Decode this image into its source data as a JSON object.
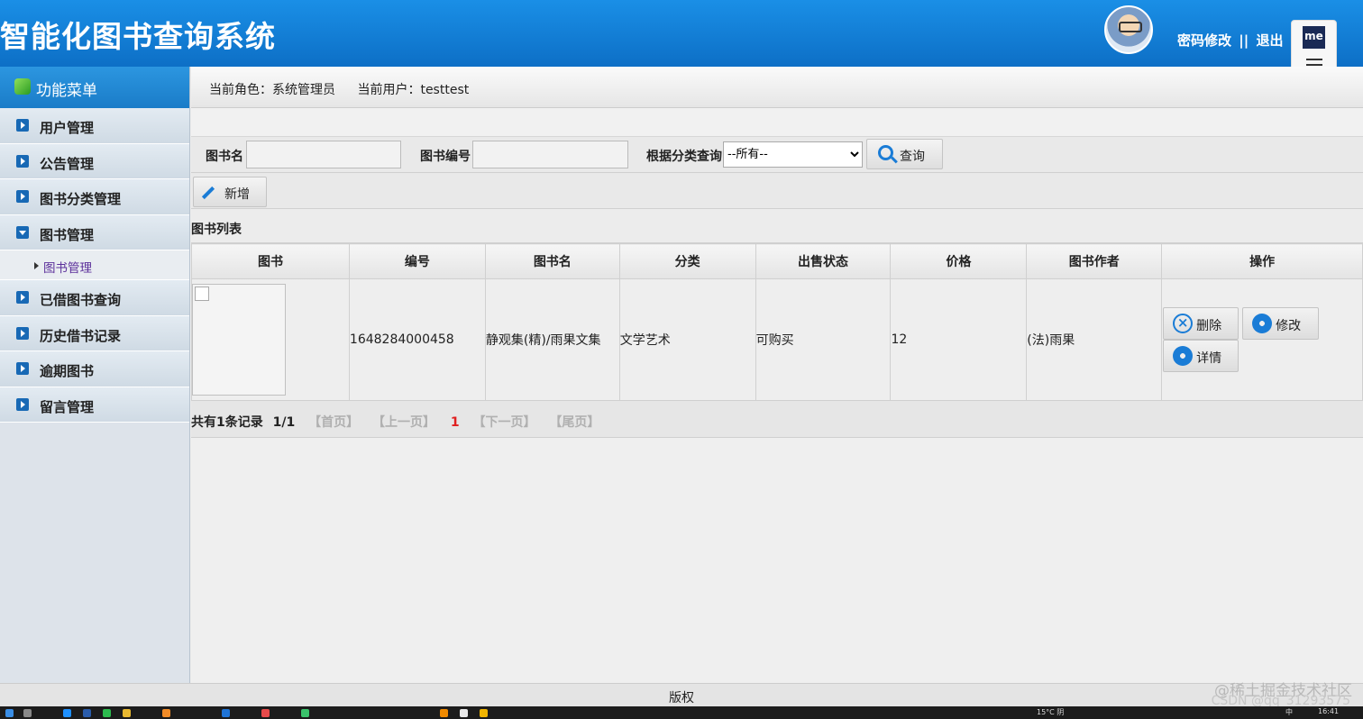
{
  "header": {
    "title": "智能化图书查询系统",
    "links": {
      "change_password": "密码修改",
      "separator": "||",
      "logout": "退出"
    }
  },
  "sidebar": {
    "heading": "功能菜单",
    "items": [
      {
        "label": "用户管理"
      },
      {
        "label": "公告管理"
      },
      {
        "label": "图书分类管理"
      },
      {
        "label": "图书管理",
        "open": true,
        "children": [
          {
            "label": "图书管理"
          }
        ]
      },
      {
        "label": "已借图书查询"
      },
      {
        "label": "历史借书记录"
      },
      {
        "label": "逾期图书"
      },
      {
        "label": "留言管理"
      }
    ]
  },
  "info_bar": {
    "role_label": "当前角色：",
    "role_value": "系统管理员",
    "user_label": "当前用户：",
    "user_value": "testtest"
  },
  "search": {
    "book_name_label": "图书名",
    "book_name_value": "",
    "book_no_label": "图书编号",
    "book_no_value": "",
    "category_label": "根据分类查询",
    "category_selected": "--所有--",
    "search_button": "查询"
  },
  "toolbar": {
    "add_button": "新增"
  },
  "list": {
    "title": "图书列表",
    "columns": [
      "图书",
      "编号",
      "图书名",
      "分类",
      "出售状态",
      "价格",
      "图书作者",
      "操作"
    ],
    "rows": [
      {
        "number": "1648284000458",
        "name": "静观集(精)/雨果文集",
        "category": "文学艺术",
        "sale_status": "可购买",
        "price": "12",
        "author": "(法)雨果",
        "actions": {
          "delete": "删除",
          "edit": "修改",
          "detail": "详情"
        }
      }
    ]
  },
  "pager": {
    "summary": "共有1条记录",
    "pages": "1/1",
    "first": "【首页】",
    "prev": "【上一页】",
    "current": "1",
    "next": "【下一页】",
    "last": "【尾页】"
  },
  "footer": {
    "copyright": "版权",
    "watermark": "@稀土掘金技术社区",
    "csdn_watermark": "CSDN @qq_31293575"
  },
  "extension": {
    "logo_text": "me"
  },
  "taskbar": {
    "weather": "15°C 阴",
    "ime": "中",
    "time": "16:41"
  },
  "colors": {
    "header_blue": "#0d6fc6",
    "accent_blue": "#1a7cd6",
    "pager_current": "#e02020"
  }
}
